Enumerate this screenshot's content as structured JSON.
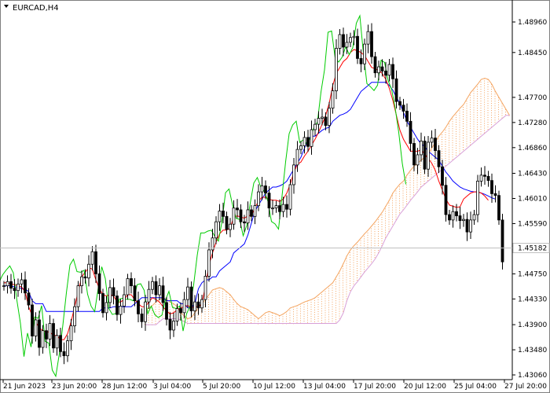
{
  "window": {
    "symbol_label": "EURCAD,H4",
    "dropdown_icon": "triangle-down-icon"
  },
  "colors": {
    "background": "#ffffff",
    "axis": "#000000",
    "candle_body": "#000000",
    "candle_hollow": "#ffffff",
    "tenkan": "#ff0000",
    "kijun": "#0000ff",
    "chikou": "#00cc00",
    "senkou_a": "#f4a460",
    "senkou_b": "#d8a0d8",
    "current_price_line": "#c0c0c0"
  },
  "chart_data": {
    "type": "line",
    "title": "EURCAD,H4",
    "indicator": "Ichimoku Kinko Hyo",
    "y_axis": {
      "min": 1.4306,
      "max": 1.4917,
      "ticks": [
        "1.48960",
        "1.48450",
        "1.47700",
        "1.47280",
        "1.46860",
        "1.46430",
        "1.46010",
        "1.45590",
        "1.45182",
        "1.44750",
        "1.44330",
        "1.43900",
        "1.43480",
        "1.43060"
      ],
      "current_price": "1.45182"
    },
    "x_axis": {
      "ticks": [
        "21 Jun 2023",
        "23 Jun 20:00",
        "28 Jun 12:00",
        "3 Jul 04:00",
        "5 Jul 20:00",
        "10 Jul 12:00",
        "13 Jul 04:00",
        "17 Jul 20:00",
        "20 Jul 12:00",
        "25 Jul 04:00",
        "27 Jul 20:00"
      ]
    },
    "candles_close": [
      1.4455,
      1.4462,
      1.4451,
      1.4447,
      1.4458,
      1.4465,
      1.4443,
      1.4423,
      1.4371,
      1.4398,
      1.4352,
      1.438,
      1.4366,
      1.4392,
      1.4351,
      1.4372,
      1.4345,
      1.4338,
      1.4363,
      1.4388,
      1.442,
      1.4455,
      1.447,
      1.4468,
      1.4491,
      1.4512,
      1.4475,
      1.4442,
      1.441,
      1.4427,
      1.4452,
      1.4438,
      1.4407,
      1.4421,
      1.444,
      1.4467,
      1.4455,
      1.443,
      1.4408,
      1.4395,
      1.4428,
      1.4449,
      1.4462,
      1.444,
      1.4455,
      1.4427,
      1.4399,
      1.4381,
      1.4396,
      1.4417,
      1.441,
      1.4432,
      1.4453,
      1.4413,
      1.4428,
      1.4418,
      1.4432,
      1.4471,
      1.4515,
      1.4535,
      1.4562,
      1.458,
      1.4571,
      1.4549,
      1.4558,
      1.4585,
      1.4582,
      1.4562,
      1.456,
      1.4582,
      1.4571,
      1.4589,
      1.4612,
      1.4622,
      1.461,
      1.4585,
      1.4585,
      1.4589,
      1.4579,
      1.4591,
      1.4583,
      1.4624,
      1.4657,
      1.4683,
      1.4689,
      1.4703,
      1.4688,
      1.4716,
      1.4725,
      1.4735,
      1.4737,
      1.4723,
      1.4752,
      1.4781,
      1.4852,
      1.4875,
      1.4854,
      1.4862,
      1.487,
      1.4872,
      1.4835,
      1.4826,
      1.4859,
      1.488,
      1.4838,
      1.4811,
      1.4821,
      1.4814,
      1.4807,
      1.4825,
      1.4801,
      1.4763,
      1.4757,
      1.4747,
      1.473,
      1.4693,
      1.4657,
      1.4674,
      1.4697,
      1.465,
      1.4695,
      1.4702,
      1.4681,
      1.4654,
      1.4623,
      1.4574,
      1.4565,
      1.4579,
      1.4572,
      1.4564,
      1.4566,
      1.4545,
      1.4565,
      1.4574,
      1.463,
      1.464,
      1.4638,
      1.4631,
      1.4609,
      1.4606,
      1.4565,
      1.4495
    ],
    "series": [
      {
        "name": "Tenkan-sen",
        "values": [
          1.446,
          1.446,
          1.4458,
          1.4457,
          1.4455,
          1.4453,
          1.4445,
          1.442,
          1.4405,
          1.4395,
          1.4385,
          1.438,
          1.4378,
          1.4378,
          1.4372,
          1.4372,
          1.4365,
          1.4365,
          1.4375,
          1.4395,
          1.442,
          1.4445,
          1.447,
          1.4478,
          1.4485,
          1.4483,
          1.4465,
          1.445,
          1.444,
          1.4438,
          1.444,
          1.4438,
          1.4428,
          1.4428,
          1.4432,
          1.444,
          1.444,
          1.4432,
          1.4425,
          1.442,
          1.442,
          1.4428,
          1.4435,
          1.4432,
          1.4428,
          1.442,
          1.4413,
          1.4408,
          1.441,
          1.4415,
          1.4418,
          1.442,
          1.4422,
          1.4418,
          1.442,
          1.442,
          1.4425,
          1.4455,
          1.449,
          1.451,
          1.4528,
          1.4542,
          1.4548,
          1.4548,
          1.4552,
          1.457,
          1.4572,
          1.457,
          1.4568,
          1.4572,
          1.4573,
          1.4585,
          1.4597,
          1.4603,
          1.4603,
          1.46,
          1.4598,
          1.4598,
          1.4596,
          1.46,
          1.461,
          1.4625,
          1.4645,
          1.4658,
          1.4662,
          1.4672,
          1.468,
          1.469,
          1.47,
          1.4712,
          1.4725,
          1.474,
          1.476,
          1.479,
          1.481,
          1.482,
          1.483,
          1.4835,
          1.4845,
          1.485,
          1.4848,
          1.4845,
          1.484,
          1.483,
          1.482,
          1.4818,
          1.4815,
          1.481,
          1.48,
          1.4785,
          1.4765,
          1.474,
          1.4715,
          1.47,
          1.469,
          1.468,
          1.468,
          1.468,
          1.4682,
          1.4675,
          1.4668,
          1.466,
          1.4648,
          1.463,
          1.4615,
          1.46,
          1.459,
          1.4588,
          1.4586,
          1.4587,
          1.46,
          1.4605,
          1.461,
          1.4612,
          1.4612,
          1.461,
          1.4605,
          1.4598
        ]
      },
      {
        "name": "Kijun-sen",
        "values": [
          1.4455,
          1.4455,
          1.4455,
          1.4453,
          1.4453,
          1.445,
          1.445,
          1.4445,
          1.443,
          1.4425,
          1.4425,
          1.4425,
          1.4412,
          1.4412,
          1.4412,
          1.4412,
          1.4412,
          1.4412,
          1.4412,
          1.4412,
          1.4412,
          1.4412,
          1.4412,
          1.4412,
          1.4412,
          1.4412,
          1.4412,
          1.4412,
          1.4418,
          1.4418,
          1.4418,
          1.442,
          1.442,
          1.442,
          1.442,
          1.442,
          1.442,
          1.4425,
          1.443,
          1.4435,
          1.4435,
          1.4435,
          1.4435,
          1.4435,
          1.4435,
          1.4435,
          1.443,
          1.443,
          1.443,
          1.443,
          1.4425,
          1.4425,
          1.4418,
          1.4418,
          1.4425,
          1.445,
          1.446,
          1.4465,
          1.4465,
          1.447,
          1.447,
          1.448,
          1.4485,
          1.449,
          1.4495,
          1.451,
          1.4515,
          1.452,
          1.4525,
          1.454,
          1.456,
          1.458,
          1.459,
          1.46,
          1.461,
          1.4615,
          1.462,
          1.462,
          1.4622,
          1.4625,
          1.463,
          1.464,
          1.465,
          1.466,
          1.467,
          1.4685,
          1.47,
          1.4705,
          1.4705,
          1.471,
          1.4715,
          1.4718,
          1.472,
          1.473,
          1.4735,
          1.474,
          1.4742,
          1.4745,
          1.475,
          1.476,
          1.477,
          1.478,
          1.4785,
          1.479,
          1.4795,
          1.4795,
          1.4795,
          1.4795,
          1.4795,
          1.479,
          1.4782,
          1.477,
          1.476,
          1.4745,
          1.473,
          1.472,
          1.471,
          1.47,
          1.4692,
          1.4688,
          1.468,
          1.4675,
          1.467,
          1.4665,
          1.4655,
          1.4645,
          1.4638,
          1.463,
          1.4625,
          1.462,
          1.4617,
          1.4615,
          1.4613,
          1.4612,
          1.4612,
          1.461,
          1.4608,
          1.4605,
          1.4602,
          1.46
        ]
      },
      {
        "name": "Chikou Span",
        "values": [
          1.4462,
          1.4451,
          1.4447,
          1.4458,
          1.4465,
          1.4443,
          1.4423,
          1.4371,
          1.4398,
          1.4352,
          1.438,
          1.4366,
          1.4392,
          1.4351,
          1.4372,
          1.4345,
          1.4338,
          1.4363,
          1.4388,
          1.442,
          1.4455,
          1.447,
          1.4468,
          1.4491,
          1.4512,
          1.4475,
          1.4442,
          1.441,
          1.4427,
          1.4452,
          1.4438,
          1.4407,
          1.4421,
          1.444,
          1.4467,
          1.4455,
          1.443,
          1.4408,
          1.4395,
          1.4428,
          1.4449,
          1.4462,
          1.444,
          1.4455,
          1.4427,
          1.4399,
          1.4381,
          1.4396,
          1.4417,
          1.441,
          1.4432,
          1.4453,
          1.4413,
          1.4428,
          1.4418,
          1.4432,
          1.4471,
          1.4515,
          1.4535,
          1.4562,
          1.458,
          1.4571,
          1.4549,
          1.4558,
          1.4585,
          1.4582,
          1.4562,
          1.456,
          1.4582,
          1.4571,
          1.4589,
          1.4612,
          1.4622,
          1.461,
          1.4585,
          1.4585,
          1.4589,
          1.4579,
          1.4591,
          1.4583,
          1.4624,
          1.4657,
          1.4683,
          1.4689,
          1.4703,
          1.4688,
          1.4716,
          1.4725,
          1.4735,
          1.4737,
          1.4723,
          1.4752,
          1.4781,
          1.4852,
          1.4875,
          1.4854,
          1.4862,
          1.487,
          1.4872,
          1.4835,
          1.4826,
          1.4859,
          1.488,
          1.4838,
          1.4811,
          1.4821,
          1.4814,
          1.4807,
          1.4825,
          1.4801,
          1.4763,
          1.4757,
          1.4747,
          1.473,
          1.4693,
          1.4657,
          1.4674,
          1.4697,
          1.465,
          1.4695,
          1.4702,
          1.4681,
          1.4654,
          1.4623,
          1.4574,
          1.4565,
          1.4579,
          1.4572,
          1.4564,
          1.4566,
          1.4545,
          1.4565,
          1.4574,
          1.463,
          1.464,
          1.4638,
          1.4631,
          1.4609,
          1.4606,
          1.4565,
          1.4495
        ]
      },
      {
        "name": "Senkou Span A",
        "values": [
          1.4415,
          1.4418,
          1.4422,
          1.4428,
          1.4432,
          1.4435,
          1.4432,
          1.4428,
          1.4425,
          1.442,
          1.441,
          1.4405,
          1.44,
          1.4402,
          1.441,
          1.4418,
          1.4425,
          1.4432,
          1.444,
          1.4448,
          1.445,
          1.4452,
          1.445,
          1.4445,
          1.444,
          1.4432,
          1.4425,
          1.442,
          1.4418,
          1.4415,
          1.441,
          1.4405,
          1.44,
          1.4405,
          1.441,
          1.4412,
          1.441,
          1.4408,
          1.4405,
          1.4408,
          1.4412,
          1.4418,
          1.442,
          1.4422,
          1.4425,
          1.4428,
          1.443,
          1.4432,
          1.4435,
          1.444,
          1.4445,
          1.445,
          1.4455,
          1.446,
          1.447,
          1.448,
          1.4492,
          1.4505,
          1.4515,
          1.4522,
          1.4528,
          1.4535,
          1.4542,
          1.4548,
          1.4555,
          1.4562,
          1.457,
          1.4578,
          1.4588,
          1.4598,
          1.461,
          1.4618,
          1.4625,
          1.463,
          1.464,
          1.4648,
          1.4655,
          1.466,
          1.4665,
          1.467,
          1.4675,
          1.4685,
          1.4695,
          1.4705,
          1.4712,
          1.472,
          1.473,
          1.4738,
          1.4745,
          1.4752,
          1.4758,
          1.4768,
          1.4778,
          1.4785,
          1.4792,
          1.48,
          1.4802,
          1.48,
          1.4792,
          1.478,
          1.477,
          1.476,
          1.475,
          1.474,
          1.4735,
          1.473
        ]
      },
      {
        "name": "Senkou Span B",
        "values": [
          1.439,
          1.439,
          1.439,
          1.439,
          1.4395,
          1.44,
          1.44,
          1.44,
          1.44,
          1.44,
          1.4398,
          1.4395,
          1.4392,
          1.4392,
          1.4392,
          1.4392,
          1.4392,
          1.4392,
          1.4392,
          1.4392,
          1.4392,
          1.4392,
          1.4392,
          1.4392,
          1.4392,
          1.4392,
          1.4392,
          1.4392,
          1.4392,
          1.4392,
          1.4392,
          1.4392,
          1.4392,
          1.4392,
          1.4392,
          1.4392,
          1.4392,
          1.4392,
          1.4392,
          1.4392,
          1.4392,
          1.4392,
          1.4392,
          1.4392,
          1.4392,
          1.4392,
          1.4392,
          1.4392,
          1.4392,
          1.4392,
          1.4392,
          1.4392,
          1.4392,
          1.4392,
          1.4392,
          1.4398,
          1.441,
          1.443,
          1.4445,
          1.4455,
          1.4462,
          1.447,
          1.4478,
          1.4485,
          1.4492,
          1.45,
          1.451,
          1.4522,
          1.4535,
          1.4545,
          1.4555,
          1.4565,
          1.4575,
          1.4582,
          1.459,
          1.4598,
          1.4605,
          1.4612,
          1.462,
          1.4625,
          1.463,
          1.4635,
          1.464,
          1.4645,
          1.465,
          1.4655,
          1.466,
          1.4665,
          1.467,
          1.4675,
          1.468,
          1.4685,
          1.469,
          1.4695,
          1.47,
          1.4705,
          1.471,
          1.4715,
          1.472,
          1.4725,
          1.473,
          1.4735,
          1.474,
          1.474,
          1.474,
          1.474
        ]
      }
    ]
  }
}
